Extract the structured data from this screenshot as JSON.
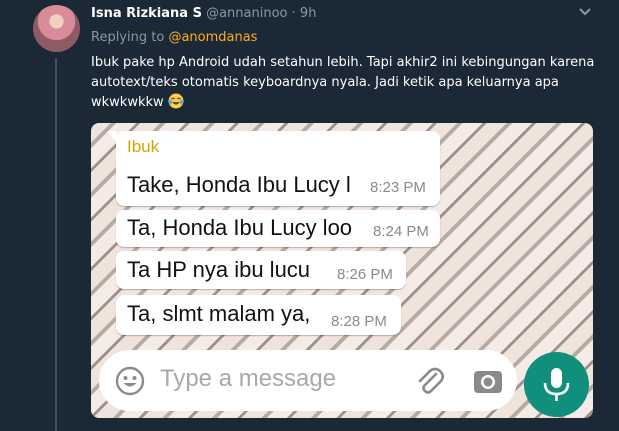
{
  "tweet": {
    "author_name": "Isna Rizkiana S",
    "author_handle": "@annaninoo",
    "separator": " · ",
    "time": "9h",
    "replying_prefix": "Replying to ",
    "replying_handle": "@anomdanas",
    "text": "Ibuk pake hp Android udah setahun lebih. Tapi akhir2 ini kebingungan karena autotext/teks otomatis keyboardnya nyala. Jadi ketik apa keluarnya apa wkwkwkkw"
  },
  "chat": {
    "sender": "Ibuk",
    "messages": [
      {
        "text": "Take, Honda Ibu Lucy l",
        "time": "8:23 PM"
      },
      {
        "text": "Ta, Honda Ibu Lucy loo",
        "time": "8:24 PM"
      },
      {
        "text": "Ta HP nya ibu  lucu",
        "time": "8:26 PM"
      },
      {
        "text": "Ta, slmt malam ya,",
        "time": "8:28 PM"
      }
    ],
    "input_placeholder": "Type a message"
  },
  "icons": {
    "chevron": "chevron-down-icon",
    "emoji": "laughing-tears-emoji-icon",
    "smiley": "emoji-smiley-icon",
    "attach": "paperclip-icon",
    "camera": "camera-icon",
    "mic": "microphone-icon"
  },
  "colors": {
    "background": "#1b2836",
    "reply_handle": "#ffad1f",
    "sender_name": "#d4a300",
    "mic_button": "#0f8f7c"
  }
}
